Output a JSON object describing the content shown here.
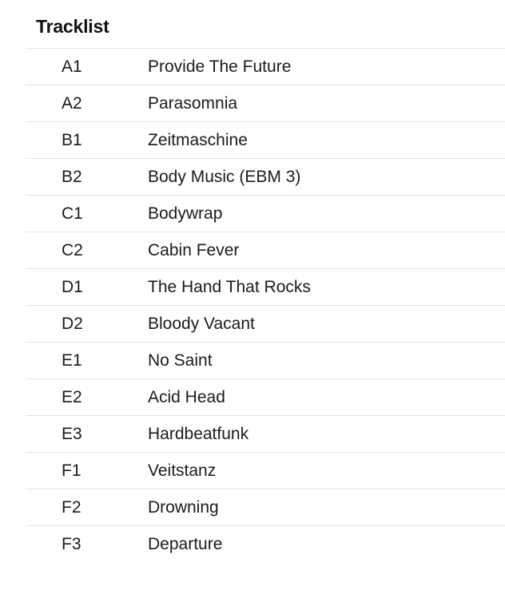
{
  "section": {
    "heading": "Tracklist"
  },
  "tracklist": {
    "columns": [
      "position",
      "title"
    ],
    "rows": [
      {
        "position": "A1",
        "title": "Provide The Future"
      },
      {
        "position": "A2",
        "title": "Parasomnia"
      },
      {
        "position": "B1",
        "title": "Zeitmaschine"
      },
      {
        "position": "B2",
        "title": "Body Music (EBM 3)"
      },
      {
        "position": "C1",
        "title": "Bodywrap"
      },
      {
        "position": "C2",
        "title": "Cabin Fever"
      },
      {
        "position": "D1",
        "title": "The Hand That Rocks"
      },
      {
        "position": "D2",
        "title": "Bloody Vacant"
      },
      {
        "position": "E1",
        "title": "No Saint"
      },
      {
        "position": "E2",
        "title": "Acid Head"
      },
      {
        "position": "E3",
        "title": "Hardbeatfunk"
      },
      {
        "position": "F1",
        "title": "Veitstanz"
      },
      {
        "position": "F2",
        "title": "Drowning"
      },
      {
        "position": "F3",
        "title": "Departure"
      }
    ]
  },
  "style": {
    "background": "#ffffff",
    "text_color": "#1b1b1b",
    "heading_color": "#111111",
    "divider_color": "#e4e4e4"
  }
}
